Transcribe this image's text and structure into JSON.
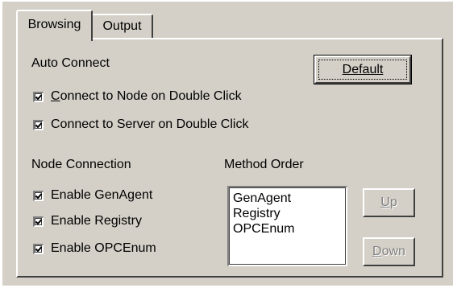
{
  "tabs": {
    "browsing": "Browsing",
    "output": "Output"
  },
  "auto_connect": {
    "title": "Auto Connect",
    "default_button": "Default",
    "options": [
      {
        "pre": "",
        "mnemonic": "C",
        "rest": "onnect to Node on Double Click",
        "checked": true
      },
      {
        "pre": "Connect to Server on Double Click",
        "mnemonic": "",
        "rest": "",
        "checked": true
      }
    ]
  },
  "node_connection": {
    "title": "Node Connection",
    "options": [
      {
        "label": "Enable GenAgent",
        "checked": true
      },
      {
        "label": "Enable Registry",
        "checked": true
      },
      {
        "label": "Enable OPCEnum",
        "checked": true
      }
    ]
  },
  "method_order": {
    "title": "Method Order",
    "items": [
      "GenAgent",
      "Registry",
      "OPCEnum"
    ],
    "up": {
      "mnemonic": "U",
      "rest": "p",
      "enabled": false
    },
    "down": {
      "mnemonic": "D",
      "rest": "own",
      "enabled": false
    }
  },
  "colors": {
    "face": "#d4d0c8",
    "highlight": "#ffffff",
    "shadow": "#808080",
    "dark_shadow": "#404040",
    "disabled_text": "#808080"
  }
}
